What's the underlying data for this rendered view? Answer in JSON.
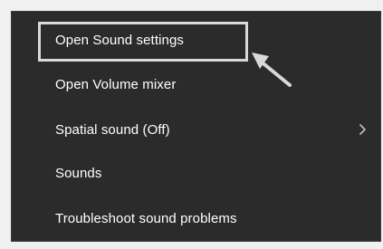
{
  "menu": {
    "items": [
      {
        "label": "Open Sound settings"
      },
      {
        "label": "Open Volume mixer"
      },
      {
        "label": "Spatial sound (Off)",
        "has_submenu": true
      },
      {
        "label": "Sounds"
      },
      {
        "label": "Troubleshoot sound problems"
      }
    ]
  },
  "colors": {
    "menu_background": "#2b2b2b",
    "menu_text": "#ffffff",
    "highlight_border": "#d9d9d9",
    "outside_background": "#f0f0f0"
  },
  "icons": {
    "submenu": "chevron-right-icon",
    "annotation": "annotation-arrow-icon"
  }
}
